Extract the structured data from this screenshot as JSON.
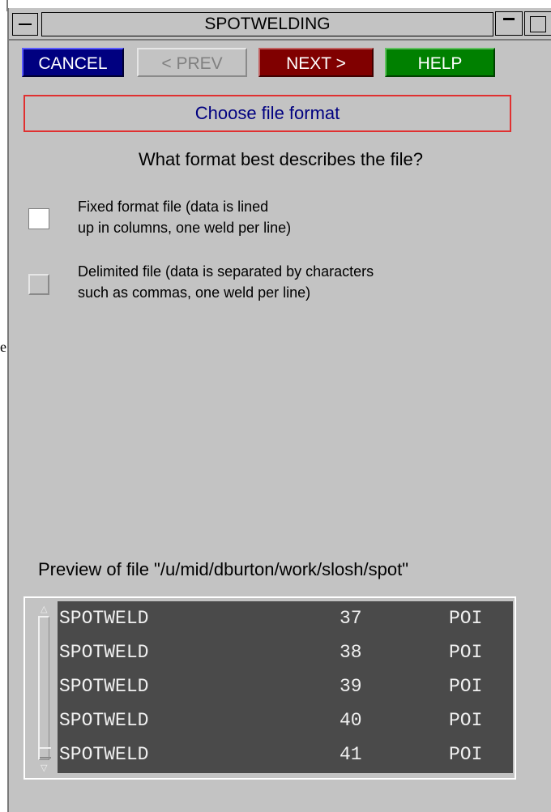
{
  "window": {
    "title": "SPOTWELDING"
  },
  "buttons": {
    "cancel": "CANCEL",
    "prev": "< PREV",
    "next": "NEXT >",
    "help": "HELP"
  },
  "heading": "Choose file format",
  "question": "What format best describes the file?",
  "options": [
    {
      "line1": "Fixed format file (data is lined",
      "line2": "up in columns, one weld per line)",
      "checked": true
    },
    {
      "line1": "Delimited file (data is separated by characters",
      "line2": "such as commas, one weld per line)",
      "checked": false
    }
  ],
  "preview": {
    "label": "Preview of file \"/u/mid/dburton/work/slosh/spot\"",
    "rows": [
      [
        "SPOTWELD",
        "37",
        "POI"
      ],
      [
        "SPOTWELD",
        "38",
        "POI"
      ],
      [
        "SPOTWELD",
        "39",
        "POI"
      ],
      [
        "SPOTWELD",
        "40",
        "POI"
      ],
      [
        "SPOTWELD",
        "41",
        "POI"
      ]
    ]
  },
  "side_text": "e",
  "colors": {
    "panel": "#c3c3c3",
    "cancel": "#000080",
    "next": "#800000",
    "help": "#008000",
    "heading_border": "#e03030",
    "heading_text": "#000080",
    "preview_bg": "#4a4a4a"
  },
  "icons": [
    "window-menu-icon",
    "minimize-icon",
    "maximize-icon",
    "scroll-up-arrow-icon",
    "scroll-down-arrow-icon"
  ]
}
